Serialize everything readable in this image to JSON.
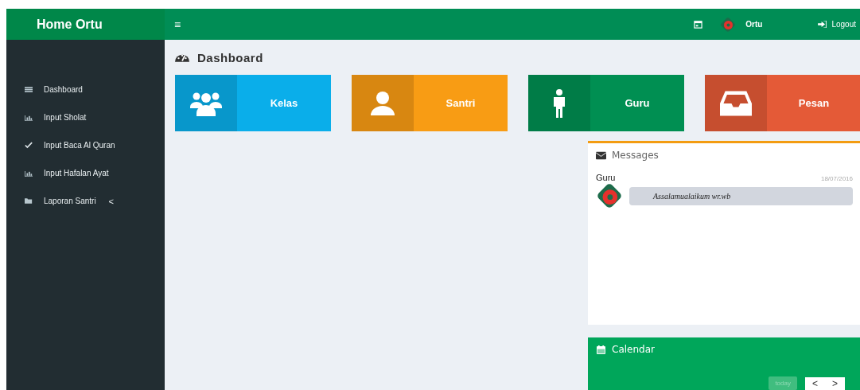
{
  "brand": "Home Ortu",
  "header": {
    "menu_toggle": "≡",
    "user": "Ortu",
    "logout": "Logout"
  },
  "sidebar": {
    "items": [
      {
        "label": "Dashboard",
        "kind": "list"
      },
      {
        "label": "Input Sholat",
        "kind": "chart"
      },
      {
        "label": "Input Baca Al Quran",
        "kind": "check"
      },
      {
        "label": "Input Hafalan Ayat",
        "kind": "chart"
      },
      {
        "label": "Laporan Santri",
        "kind": "folder",
        "caret": "<"
      }
    ]
  },
  "page_title": "Dashboard",
  "tiles": [
    {
      "label": "Kelas",
      "kind": "users",
      "color": "#0aaeea"
    },
    {
      "label": "Santri",
      "kind": "user",
      "color": "#f89c14"
    },
    {
      "label": "Guru",
      "kind": "male",
      "color": "#008f52"
    },
    {
      "label": "Pesan",
      "kind": "inbox",
      "color": "#e45a37"
    }
  ],
  "messages": {
    "title": "Messages",
    "items": [
      {
        "sender": "Guru",
        "time": "18/07/2016",
        "text": "Assalamualaikum wr.wb"
      }
    ]
  },
  "calendar": {
    "title": "Calendar",
    "today": {
      "label": "today",
      "disabled": true
    },
    "prev": "<",
    "next": ">"
  }
}
